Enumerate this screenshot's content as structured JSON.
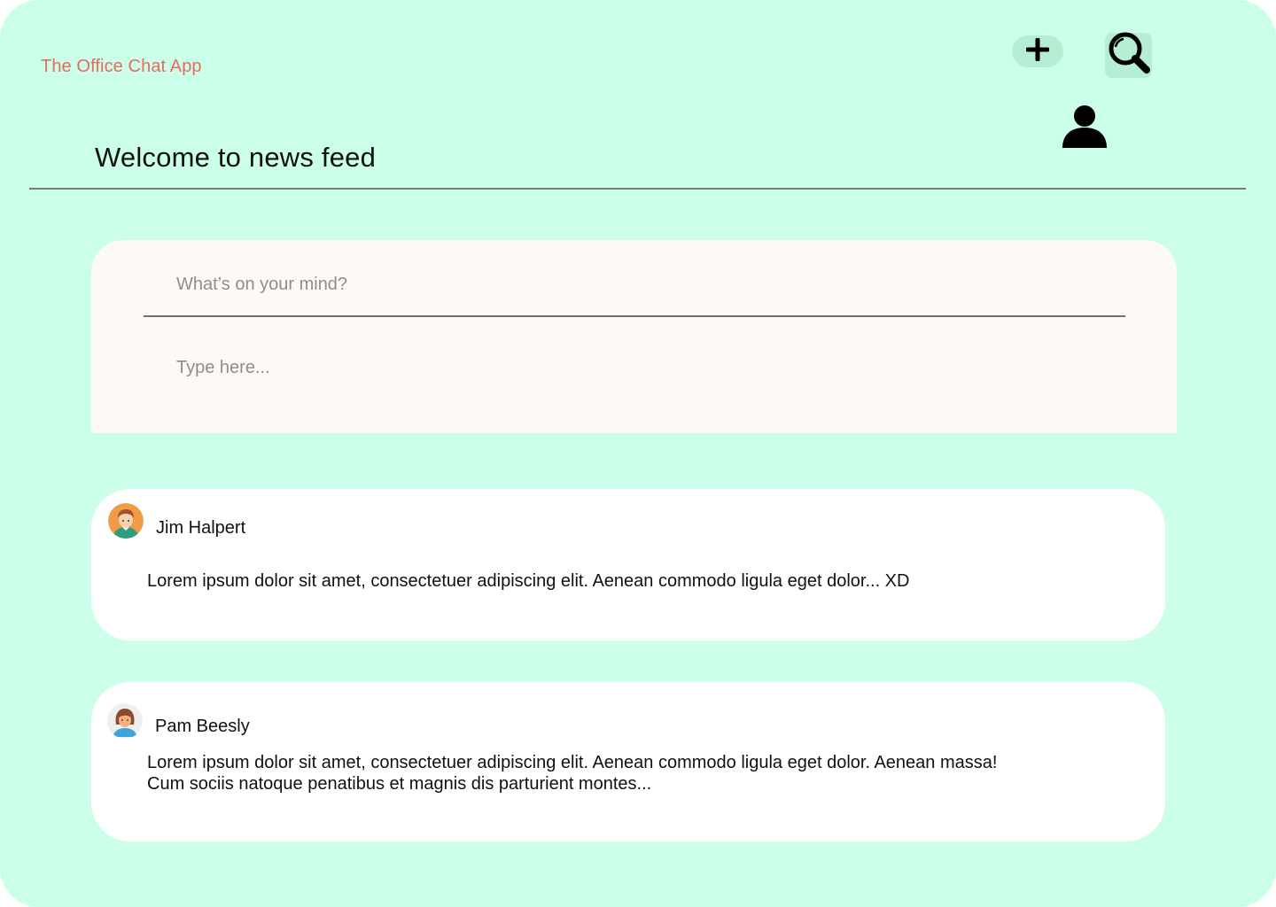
{
  "app": {
    "title": "The Office Chat App"
  },
  "header": {
    "page_title": "Welcome to news feed",
    "icons": [
      "plus-icon",
      "search-icon",
      "user-icon"
    ]
  },
  "composer": {
    "title_placeholder": "What’s on your mind?",
    "body_placeholder": "Type here..."
  },
  "posts": [
    {
      "author": "Jim Halpert",
      "avatar": "male-avatar",
      "text": "Lorem ipsum dolor sit amet, consectetuer adipiscing elit. Aenean commodo ligula eget dolor... XD"
    },
    {
      "author": "Pam Beesly",
      "avatar": "female-avatar",
      "text": "Lorem ipsum dolor sit amet, consectetuer adipiscing elit. Aenean commodo ligula eget dolor. Aenean massa!  Cum sociis natoque penatibus et magnis dis parturient montes..."
    }
  ],
  "colors": {
    "background": "#CBFFE9",
    "app_title": "#E86A5E",
    "card": "#FFFFFF",
    "composer": "#FDF9F7"
  }
}
